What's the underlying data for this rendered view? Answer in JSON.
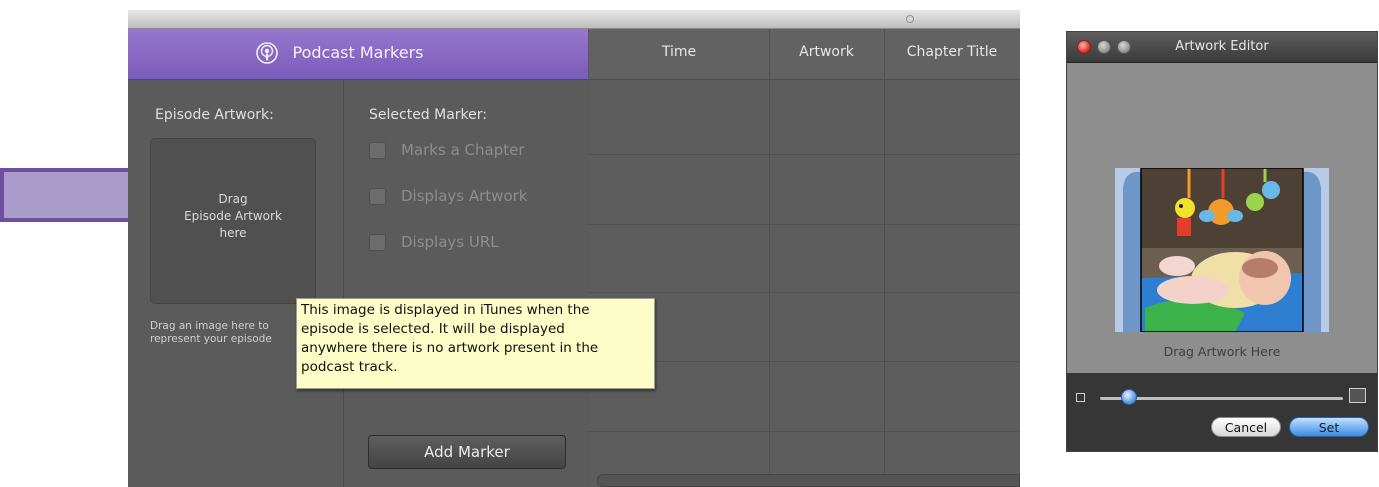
{
  "app": {
    "header_title": "Podcast Markers",
    "episode_artwork_label": "Episode Artwork:",
    "artwork_well_text": "Drag\nEpisode Artwork\nhere",
    "artwork_help_text": "Drag an image here to\nrepresent your episode",
    "selected_marker_label": "Selected Marker:",
    "checkboxes": [
      {
        "label": "Marks a Chapter",
        "checked": false
      },
      {
        "label": "Displays Artwork",
        "checked": false
      },
      {
        "label": "Displays URL",
        "checked": false
      }
    ],
    "add_marker_label": "Add Marker",
    "table": {
      "columns": [
        "Time",
        "Artwork",
        "Chapter Title"
      ]
    },
    "tooltip": "This image is displayed in iTunes when the\nepisode is selected. It will be displayed\nanywhere there is no artwork present in the\npodcast track."
  },
  "editor": {
    "title": "Artwork Editor",
    "drag_hint": "Drag Artwork Here",
    "cancel_label": "Cancel",
    "set_label": "Set",
    "zoom_level": 0.12
  },
  "colors": {
    "header_purple": "#8a6bc6",
    "arrow_fill": "#a99ccb",
    "arrow_stroke": "#6f4d9f",
    "tooltip_bg": "#fdfdc8",
    "set_button_blue": "#3e8ce0"
  },
  "icons": [
    "arrow-right-icon",
    "podcast-icon",
    "close-icon",
    "minimize-icon",
    "zoom-icon",
    "small-image-icon",
    "large-image-icon"
  ]
}
